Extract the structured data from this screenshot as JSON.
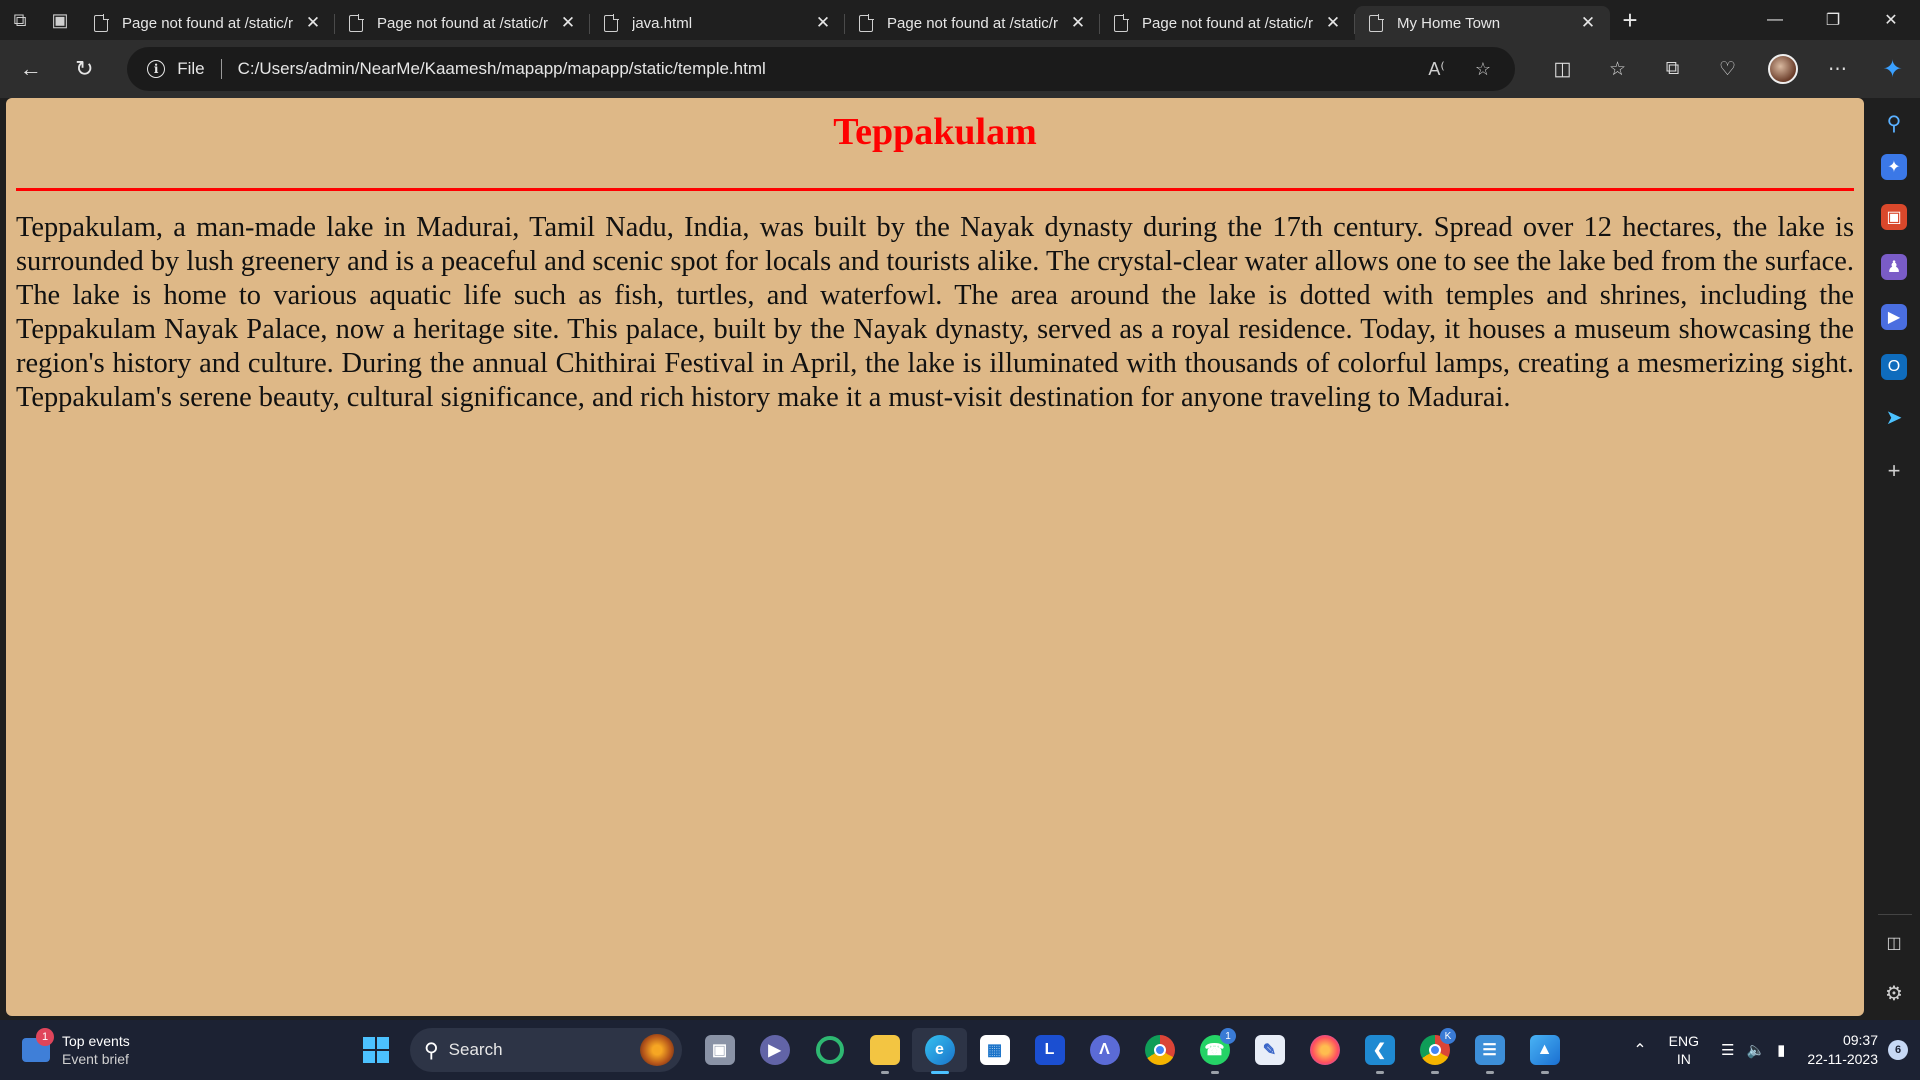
{
  "browser": {
    "tabs": [
      {
        "title": "Page not found at /static/r",
        "active": false
      },
      {
        "title": "Page not found at /static/r",
        "active": false
      },
      {
        "title": "java.html",
        "active": false
      },
      {
        "title": "Page not found at /static/r",
        "active": false
      },
      {
        "title": "Page not found at /static/r",
        "active": false
      },
      {
        "title": "My Home Town",
        "active": true
      }
    ],
    "address": {
      "scheme_label": "File",
      "url": "C:/Users/admin/NearMe/Kaamesh/mapapp/mapapp/static/temple.html"
    }
  },
  "page": {
    "heading": "Teppakulam",
    "heading_color": "#ff0000",
    "background_color": "#deb887",
    "body": "Teppakulam, a man-made lake in Madurai, Tamil Nadu, India, was built by the Nayak dynasty during the 17th century. Spread over 12 hectares, the lake is surrounded by lush greenery and is a peaceful and scenic spot for locals and tourists alike. The crystal-clear water allows one to see the lake bed from the surface. The lake is home to various aquatic life such as fish, turtles, and waterfowl. The area around the lake is dotted with temples and shrines, including the Teppakulam Nayak Palace, now a heritage site. This palace, built by the Nayak dynasty, served as a royal residence. Today, it houses a museum showcasing the region's history and culture. During the annual Chithirai Festival in April, the lake is illuminated with thousands of colorful lamps, creating a mesmerizing sight. Teppakulam's serene beauty, cultural significance, and rich history make it a must-visit destination for anyone traveling to Madurai."
  },
  "taskbar": {
    "widget": {
      "title": "Top events",
      "subtitle": "Event brief",
      "badge": "1"
    },
    "search_placeholder": "Search",
    "whatsapp_badge": "1",
    "chrome_profile_badge": "K",
    "language": {
      "line1": "ENG",
      "line2": "IN"
    },
    "time": "09:37",
    "date": "22-11-2023",
    "notification_count": "6"
  }
}
